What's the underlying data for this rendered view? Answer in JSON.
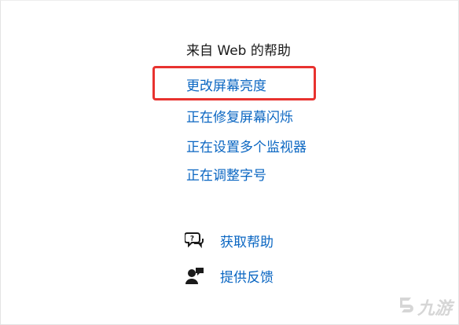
{
  "panel": {
    "heading": "来自 Web 的帮助",
    "links": [
      {
        "label": "更改屏幕亮度",
        "highlighted": true
      },
      {
        "label": "正在修复屏幕闪烁"
      },
      {
        "label": "正在设置多个监视器"
      },
      {
        "label": "正在调整字号"
      }
    ],
    "highlight_color": "#e8322f",
    "link_color": "#0a66c2"
  },
  "actions": [
    {
      "label": "获取帮助",
      "icon": "chat-help-icon"
    },
    {
      "label": "提供反馈",
      "icon": "feedback-person-icon"
    }
  ],
  "watermark": {
    "text": "九游",
    "icon": "nine-game-logo-icon"
  }
}
